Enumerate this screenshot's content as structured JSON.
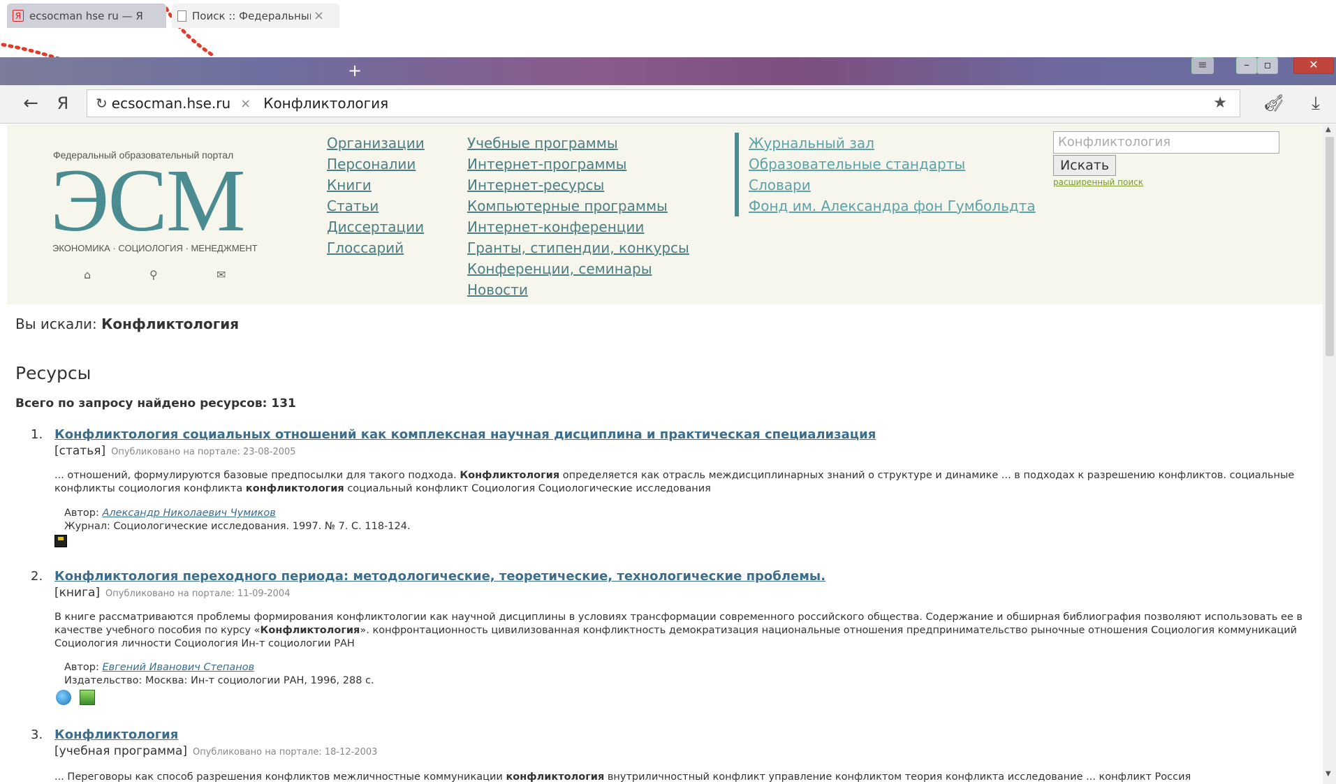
{
  "browser": {
    "tabs": [
      {
        "icon": "Я",
        "title": "ecsocman hse ru — Я"
      },
      {
        "title": "Поиск :: Федеральный",
        "close": "×"
      }
    ],
    "new_tab": "+",
    "nav": {
      "back": "←",
      "yandex": "Я"
    },
    "address": {
      "host": "ecsocman.hse.ru",
      "query": "Конфликтология",
      "clear": "×"
    }
  },
  "site": {
    "logo": {
      "caption": "Федеральный образовательный портал",
      "name": "ЭСМ",
      "subtitle": "ЭКОНОМИКА · СОЦИОЛОГИЯ · МЕНЕДЖМЕНТ"
    },
    "nav_col1": [
      "Организации",
      "Персоналии",
      "Книги",
      "Статьи",
      "Диссертации",
      "Глоссарий"
    ],
    "nav_col2": [
      "Учебные программы",
      "Интернет-программы",
      "Интернет-ресурсы",
      "Компьютерные программы",
      "Интернет-конференции",
      "Гранты, стипендии, конкурсы",
      "Конференции, семинары",
      "Новости"
    ],
    "nav_col3": [
      "Журнальный зал",
      "Образовательные стандарты",
      "Словари",
      "Фонд им. Александра фон Гумбольдта"
    ],
    "search": {
      "placeholder": "Конфликтология",
      "button": "Искать",
      "advanced": "расширенный поиск"
    }
  },
  "results": {
    "you_searched_label": "Вы искали: ",
    "you_searched_query": "Конфликтология",
    "heading": "Ресурсы",
    "total": "Всего по запросу найдено ресурсов: 131",
    "items": [
      {
        "num": "1.",
        "title": "Конфликтология социальных отношений как комплексная научная дисциплина и практическая специализация",
        "kind": "[статья]",
        "published": "Опубликовано на портале: 23-08-2005",
        "snippet_a": "... отношений, формулируются базовые предпосылки для такого подхода. ",
        "snippet_b": "Конфликтология",
        "snippet_c": " определяется как отрасль междисциплинарных знаний о структуре и динамике ... в подходах к разрешению конфликтов. социальные конфликты социология конфликта ",
        "snippet_d": "конфликтология",
        "snippet_e": " социальный конфликт Социология Социологические исследования",
        "author_label": "Автор: ",
        "author": "Александр Николаевич Чумиков",
        "source": "Журнал: Социологические исследования. 1997.  № 7. С. 118-124."
      },
      {
        "num": "2.",
        "title": "Конфликтология переходного периода: методологические, теоретические, технологические проблемы.",
        "kind": "[книга]",
        "published": "Опубликовано на портале: 11-09-2004",
        "snippet_a": "В книге рассматриваются проблемы формирования конфликтологии как научной дисциплины в условиях трансформации современного российского общества. Содержание и обширная библиография позволяют использовать ее в качестве учебного пособия по курсу «",
        "snippet_b": "Конфликтология",
        "snippet_c": "». конфронтационность цивилизованная конфликтность демократизация национальные отношения предпринимательство рыночные отношения Социология коммуникаций Социология личности Социология Ин-т социологии РАН",
        "author_label": "Автор: ",
        "author": "Евгений Иванович Степанов",
        "source": "Издательство: Москва: Ин-т социологии РАН, 1996, 288 с."
      },
      {
        "num": "3.",
        "title": "Конфликтология",
        "kind": "[учебная программа]",
        "published": "Опубликовано на портале: 18-12-2003",
        "snippet_a": "... Переговоры как способ разрешения конфликтов межличностные коммуникации ",
        "snippet_b": "конфликтология",
        "snippet_c": " внутриличностный конфликт управление конфликтом теория конфликта исследование ... конфликт Россия"
      }
    ]
  }
}
